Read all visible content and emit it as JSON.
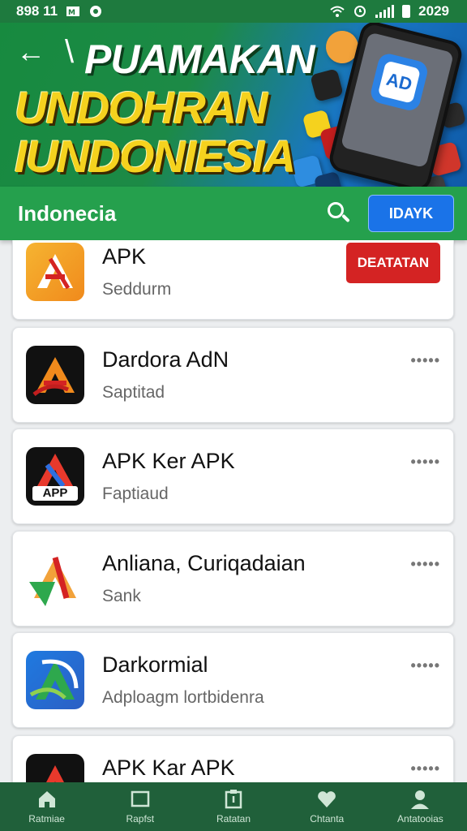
{
  "status_bar": {
    "time": "898 11",
    "battery_text": "2029"
  },
  "banner": {
    "line1": "PUAMAKAN",
    "line2": "UNDOHRAN",
    "line3": "IUNDONIESIA",
    "phone_app_text": "AD"
  },
  "appbar": {
    "title": "Indonecia",
    "action_label": "IDAYK"
  },
  "apps": [
    {
      "name": "APK",
      "subtitle": "Seddurm",
      "button": "DEATATAN"
    },
    {
      "name": "Dardora AdN",
      "subtitle": "Saptitad",
      "more": "•••••"
    },
    {
      "name": "APK Ker APK",
      "subtitle": "Faptiaud",
      "more": "•••••",
      "icon_text": "APP"
    },
    {
      "name": "Anliana, Curiqadaian",
      "subtitle": "Sank",
      "more": "•••••"
    },
    {
      "name": "Darkormial",
      "subtitle": "Adploagm lortbidenra",
      "more": "•••••"
    },
    {
      "name": "APK Kar APK",
      "subtitle": "",
      "more": "•••••"
    }
  ],
  "bottom_nav": [
    {
      "label": "Ratmiae",
      "icon": "home-icon"
    },
    {
      "label": "Rapfst",
      "icon": "square-icon"
    },
    {
      "label": "Ratatan",
      "icon": "clipboard-icon"
    },
    {
      "label": "Chtanta",
      "icon": "heart-icon"
    },
    {
      "label": "Antatooias",
      "icon": "person-icon"
    }
  ],
  "colors": {
    "primary_green": "#25a04d",
    "accent_blue": "#1a73e8",
    "install_red": "#d42323"
  }
}
